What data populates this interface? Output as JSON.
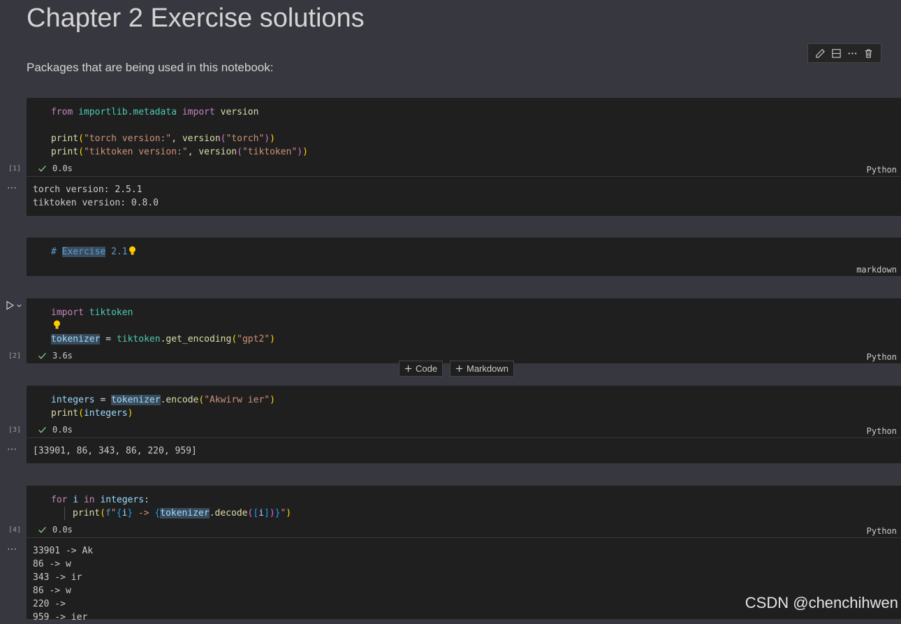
{
  "markdown": {
    "title": "Chapter 2 Exercise solutions",
    "paragraph": "Packages that are being used in this notebook:"
  },
  "toolbar": {
    "icons": [
      "pencil-icon",
      "split-cell-icon",
      "more-icon",
      "trash-icon"
    ]
  },
  "cells": [
    {
      "exec_count": "[1]",
      "status_time": "0.0s",
      "language": "Python",
      "output": [
        "torch version: 2.5.1",
        "tiktoken version: 0.8.0"
      ]
    },
    {
      "language": "markdown",
      "source_prefix": "# ",
      "source_word": "Exercise",
      "source_number": "2.1"
    },
    {
      "exec_count": "[2]",
      "status_time": "3.6s",
      "language": "Python"
    },
    {
      "exec_count": "[3]",
      "status_time": "0.0s",
      "language": "Python",
      "output": [
        "[33901, 86, 343, 86, 220, 959]"
      ]
    },
    {
      "exec_count": "[4]",
      "status_time": "0.0s",
      "language": "Python",
      "output": [
        "33901 -> Ak",
        "86 -> w",
        "343 -> ir",
        "86 -> w",
        "220 -> ",
        "959 -> ier"
      ]
    }
  ],
  "code": {
    "c1_from": "from",
    "c1_mod": "importlib.metadata",
    "c1_import": "import",
    "c1_name": "version",
    "c1_print": "print",
    "c1_str1": "\"torch version:\"",
    "c1_version": "version",
    "c1_str2": "\"torch\"",
    "c1_str3": "\"tiktoken version:\"",
    "c1_str4": "\"tiktoken\"",
    "c2_import": "import",
    "c2_mod": "tiktoken",
    "c2_var": "tokenizer",
    "c2_mod2": "tiktoken",
    "c2_fn": "get_encoding",
    "c2_str": "\"gpt2\"",
    "c3_var": "integers",
    "c3_tok": "tokenizer",
    "c3_fn": "encode",
    "c3_str": "\"Akwirw ier\"",
    "c3_print": "print",
    "c3_arg": "integers",
    "c4_for": "for",
    "c4_i": "i",
    "c4_in": "in",
    "c4_iter": "integers",
    "c4_print": "print",
    "c4_f": "f",
    "c4_q1": "\"",
    "c4_i2": "i",
    "c4_arrow": " -> ",
    "c4_tok": "tokenizer",
    "c4_fn": "decode",
    "c4_i3": "i",
    "c4_q2": "\""
  },
  "add_buttons": {
    "code": "Code",
    "markdown": "Markdown"
  },
  "watermark": "CSDN @chenchihwen",
  "colors": {
    "background": "#37373f",
    "cell": "#1f1f1f",
    "check": "#89d185",
    "bulb": "#ffcc00"
  }
}
